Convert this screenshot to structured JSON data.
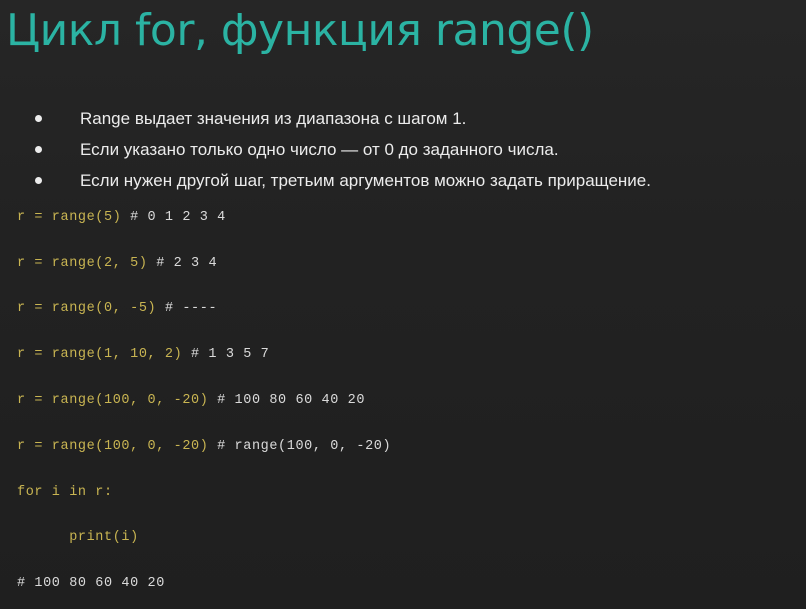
{
  "slide": {
    "title": "Цикл for, функция range()",
    "title_color": "#2bb3a3",
    "bullets": [
      "Range выдает значения из диапазона с шагом 1.",
      "Если указано только одно число — от 0 до заданного числа.",
      "Если нужен другой шаг, третьим аргументов можно задать приращение."
    ],
    "code_lines": [
      {
        "code": "r = range(5) ",
        "comment": "# 0 1 2 3 4"
      },
      {
        "code": "r = range(2, 5) ",
        "comment": "# 2 3 4"
      },
      {
        "code": "r = range(0, -5) ",
        "comment": "# ----"
      },
      {
        "code": "r = range(1, 10, 2) ",
        "comment": "# 1 3 5 7"
      },
      {
        "code": "r = range(100, 0, -20) ",
        "comment": "# 100 80 60 40 20"
      },
      {
        "code": "r = range(100, 0, -20) ",
        "comment": "# range(100, 0, -20)"
      },
      {
        "code": "for i in r:",
        "comment": ""
      },
      {
        "code": "      print(i)",
        "comment": ""
      },
      {
        "code": "",
        "comment": "# 100 80 60 40 20"
      }
    ],
    "colors": {
      "background": "#222222",
      "title": "#2bb3a3",
      "bullet_text": "#ececec",
      "code": "#c9b552",
      "comment": "#dadada"
    }
  }
}
